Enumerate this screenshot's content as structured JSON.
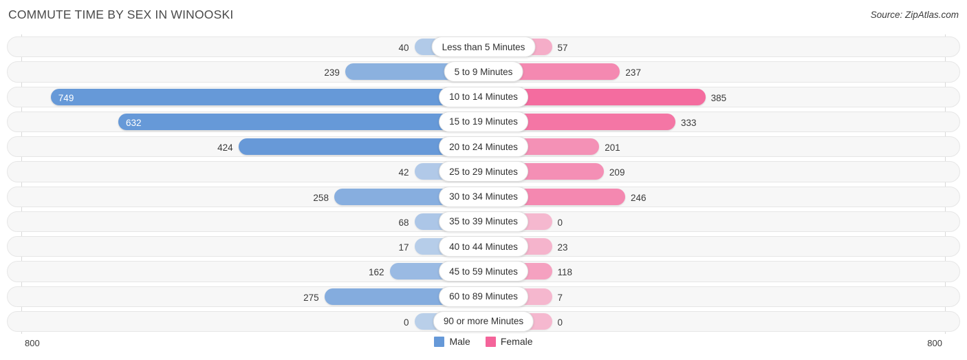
{
  "header": {
    "title": "COMMUTE TIME BY SEX IN WINOOSKI",
    "source": "Source: ZipAtlas.com"
  },
  "axis": {
    "left_label": "800",
    "right_label": "800"
  },
  "legend": {
    "items": [
      {
        "label": "Male",
        "color": "#6699d8"
      },
      {
        "label": "Female",
        "color": "#f4649a"
      }
    ]
  },
  "chart_data": {
    "type": "bar",
    "subtype": "diverging-bidirectional",
    "title": "COMMUTE TIME BY SEX IN WINOOSKI",
    "xlabel": "",
    "ylabel": "",
    "xlim": [
      800,
      800
    ],
    "axis_max": 800,
    "grid": true,
    "legend_position": "bottom-center",
    "categories": [
      "Less than 5 Minutes",
      "5 to 9 Minutes",
      "10 to 14 Minutes",
      "15 to 19 Minutes",
      "20 to 24 Minutes",
      "25 to 29 Minutes",
      "30 to 34 Minutes",
      "35 to 39 Minutes",
      "40 to 44 Minutes",
      "45 to 59 Minutes",
      "60 to 89 Minutes",
      "90 or more Minutes"
    ],
    "series": [
      {
        "name": "Male",
        "color": "#6699d8",
        "direction": "left",
        "values": [
          40,
          239,
          749,
          632,
          424,
          42,
          258,
          68,
          17,
          162,
          275,
          0
        ]
      },
      {
        "name": "Female",
        "color": "#f4649a",
        "direction": "right",
        "values": [
          57,
          237,
          385,
          333,
          201,
          209,
          246,
          0,
          23,
          118,
          7,
          0
        ]
      }
    ],
    "rows": [
      {
        "category": "Less than 5 Minutes",
        "male": 40,
        "female": 57,
        "male_label": "40",
        "female_label": "57",
        "male_inside": false,
        "female_inside": false
      },
      {
        "category": "5 to 9 Minutes",
        "male": 239,
        "female": 237,
        "male_label": "239",
        "female_label": "237",
        "male_inside": false,
        "female_inside": false
      },
      {
        "category": "10 to 14 Minutes",
        "male": 749,
        "female": 385,
        "male_label": "749",
        "female_label": "385",
        "male_inside": true,
        "female_inside": false
      },
      {
        "category": "15 to 19 Minutes",
        "male": 632,
        "female": 333,
        "male_label": "632",
        "female_label": "333",
        "male_inside": true,
        "female_inside": false
      },
      {
        "category": "20 to 24 Minutes",
        "male": 424,
        "female": 201,
        "male_label": "424",
        "female_label": "201",
        "male_inside": false,
        "female_inside": false
      },
      {
        "category": "25 to 29 Minutes",
        "male": 42,
        "female": 209,
        "male_label": "42",
        "female_label": "209",
        "male_inside": false,
        "female_inside": false
      },
      {
        "category": "30 to 34 Minutes",
        "male": 258,
        "female": 246,
        "male_label": "258",
        "female_label": "246",
        "male_inside": false,
        "female_inside": false
      },
      {
        "category": "35 to 39 Minutes",
        "male": 68,
        "female": 0,
        "male_label": "68",
        "female_label": "0",
        "male_inside": false,
        "female_inside": false
      },
      {
        "category": "40 to 44 Minutes",
        "male": 17,
        "female": 23,
        "male_label": "17",
        "female_label": "23",
        "male_inside": false,
        "female_inside": false
      },
      {
        "category": "45 to 59 Minutes",
        "male": 162,
        "female": 118,
        "male_label": "162",
        "female_label": "118",
        "male_inside": false,
        "female_inside": false
      },
      {
        "category": "60 to 89 Minutes",
        "male": 275,
        "female": 7,
        "male_label": "275",
        "female_label": "7",
        "male_inside": false,
        "female_inside": false
      },
      {
        "category": "90 or more Minutes",
        "male": 0,
        "female": 0,
        "male_label": "0",
        "female_label": "0",
        "male_inside": false,
        "female_inside": false
      }
    ]
  }
}
